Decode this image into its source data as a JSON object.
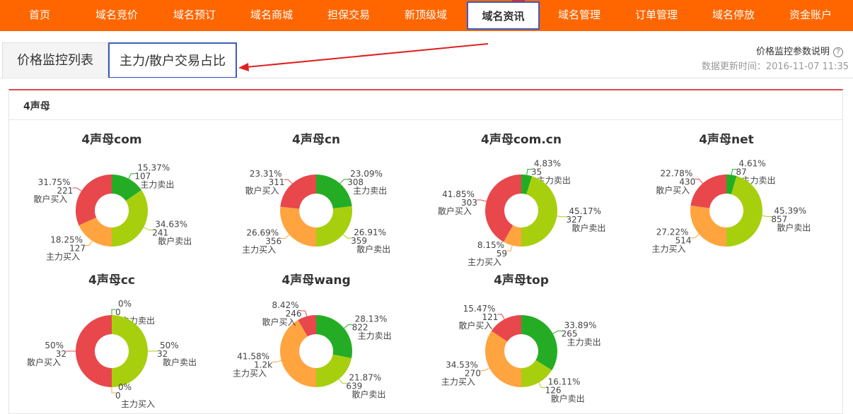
{
  "nav": {
    "items": [
      "首页",
      "域名竞价",
      "域名预订",
      "域名商城",
      "担保交易",
      "新顶级域",
      "域名资讯",
      "域名管理",
      "订单管理",
      "域名停放",
      "资金账户"
    ],
    "active": "域名资讯"
  },
  "tabs": {
    "list_label": "价格监控列表",
    "ratio_label": "主力/散户交易占比"
  },
  "header": {
    "help_label": "价格监控参数说明",
    "help_icon": "?",
    "update_label": "数据更新时间：2016-11-07 11:35"
  },
  "panel": {
    "title": "4声母"
  },
  "colors": {
    "主力卖出": "#24ad24",
    "散户卖出": "#a8cf0e",
    "主力买入": "#ffa43f",
    "散户买入": "#e8474c",
    "accent": "#ff6600"
  },
  "chart_data": [
    {
      "type": "pie",
      "title": "4声母com",
      "slices": [
        {
          "label": "主力卖出",
          "value": 107,
          "percent": "15.37%"
        },
        {
          "label": "散户卖出",
          "value": 241,
          "percent": "34.63%"
        },
        {
          "label": "主力买入",
          "value": 127,
          "percent": "18.25%"
        },
        {
          "label": "散户买入",
          "value": 221,
          "percent": "31.75%"
        }
      ]
    },
    {
      "type": "pie",
      "title": "4声母cn",
      "slices": [
        {
          "label": "主力卖出",
          "value": 308,
          "percent": "23.09%"
        },
        {
          "label": "散户卖出",
          "value": 359,
          "percent": "26.91%"
        },
        {
          "label": "主力买入",
          "value": 356,
          "percent": "26.69%"
        },
        {
          "label": "散户买入",
          "value": 311,
          "percent": "23.31%"
        }
      ]
    },
    {
      "type": "pie",
      "title": "4声母com.cn",
      "slices": [
        {
          "label": "主力卖出",
          "value": 35,
          "percent": "4.83%"
        },
        {
          "label": "散户卖出",
          "value": 327,
          "percent": "45.17%"
        },
        {
          "label": "主力买入",
          "value": 59,
          "percent": "8.15%"
        },
        {
          "label": "散户买入",
          "value": 303,
          "percent": "41.85%"
        }
      ]
    },
    {
      "type": "pie",
      "title": "4声母net",
      "slices": [
        {
          "label": "主力卖出",
          "value": 87,
          "percent": "4.61%"
        },
        {
          "label": "散户卖出",
          "value": 857,
          "percent": "45.39%"
        },
        {
          "label": "主力买入",
          "value": 514,
          "percent": "27.22%"
        },
        {
          "label": "散户买入",
          "value": 430,
          "percent": "22.78%"
        }
      ]
    },
    {
      "type": "pie",
      "title": "4声母cc",
      "slices": [
        {
          "label": "主力卖出",
          "value": 0,
          "percent": "0%"
        },
        {
          "label": "散户卖出",
          "value": 32,
          "percent": "50%"
        },
        {
          "label": "主力买入",
          "value": 0,
          "percent": "0%"
        },
        {
          "label": "散户买入",
          "value": 32,
          "percent": "50%"
        }
      ]
    },
    {
      "type": "pie",
      "title": "4声母wang",
      "slices": [
        {
          "label": "主力卖出",
          "value": 822,
          "percent": "28.13%"
        },
        {
          "label": "散户卖出",
          "value": 639,
          "percent": "21.87%"
        },
        {
          "label": "主力买入",
          "value": 1215,
          "display": "1.2k",
          "percent": "41.58%"
        },
        {
          "label": "散户买入",
          "value": 246,
          "percent": "8.42%"
        }
      ]
    },
    {
      "type": "pie",
      "title": "4声母top",
      "slices": [
        {
          "label": "主力卖出",
          "value": 265,
          "percent": "33.89%"
        },
        {
          "label": "散户卖出",
          "value": 126,
          "percent": "16.11%"
        },
        {
          "label": "主力买入",
          "value": 270,
          "percent": "34.53%"
        },
        {
          "label": "散户买入",
          "value": 121,
          "percent": "15.47%"
        }
      ]
    }
  ]
}
